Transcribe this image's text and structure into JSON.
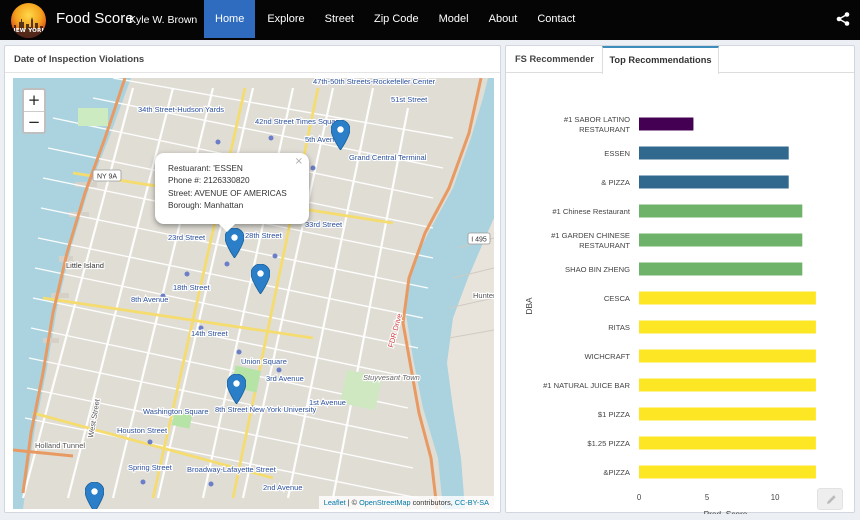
{
  "navbar": {
    "logo_text": "NEW YORK",
    "brand": "Food Score",
    "author": "Kyle W. Brown",
    "items": [
      {
        "label": "Home",
        "active": true
      },
      {
        "label": "Explore",
        "active": false
      },
      {
        "label": "Street",
        "active": false
      },
      {
        "label": "Zip Code",
        "active": false
      },
      {
        "label": "Model",
        "active": false
      },
      {
        "label": "About",
        "active": false
      },
      {
        "label": "Contact",
        "active": false
      }
    ],
    "share_icon": "share-icon"
  },
  "map_panel": {
    "title": "Date of Inspection Violations",
    "zoom_in": "+",
    "zoom_out": "−",
    "popup": {
      "line1": "Restuarant: 'ESSEN",
      "line2": "Phone #: 2126330820",
      "line3": "Street: AVENUE OF AMERICAS",
      "line4": "Borough: Manhattan",
      "close": "×"
    },
    "attribution": {
      "leaflet": "Leaflet",
      "sep": " | © ",
      "osm": "OpenStreetMap",
      "contrib": " contributors, ",
      "license": "CC-BY-SA"
    },
    "map_labels": [
      "34th Street-Hudson Yards",
      "47th-50th Streets-Rockefeller Center",
      "42nd Street Times Square",
      "5th Avenue",
      "Grand Central Terminal",
      "51st Street",
      "NY 9A",
      "33rd Street",
      "28th Street",
      "23rd Street",
      "Little Island",
      "18th Street",
      "8th Avenue",
      "14th Street",
      "Union Square",
      "3rd Avenue",
      "1st Avenue",
      "Washington Square",
      "8th Street New York University",
      "Houston Street",
      "Spring Street",
      "Broadway-Lafayette Street",
      "Holland Tunnel",
      "I 495",
      "FDR Drive",
      "Hunters Point",
      "West Street",
      "Stuyvesant Town",
      "2nd Avenue"
    ]
  },
  "chart_panel": {
    "tabs": [
      {
        "label": "FS Recommender",
        "active": false
      },
      {
        "label": "Top Recommendations",
        "active": true
      }
    ],
    "edit_icon": "pencil-icon"
  },
  "chart_data": {
    "type": "bar",
    "orientation": "horizontal",
    "categories": [
      "#1 SABOR LATINO RESTAURANT",
      "ESSEN",
      "& PIZZA",
      "#1 Chinese Restaurant",
      "#1 GARDEN CHINESE RESTAURANT",
      "SHAO BIN ZHENG",
      "CESCA",
      "RITAS",
      "WICHCRAFT",
      "#1 NATURAL JUICE BAR",
      "$1 PIZZA",
      "$1.25 PIZZA",
      "&PIZZA"
    ],
    "values": [
      4,
      11,
      11,
      12,
      12,
      12,
      13,
      13,
      13,
      13,
      13,
      13,
      13
    ],
    "colors": [
      "#440154",
      "#31688e",
      "#31688e",
      "#6fb36a",
      "#6fb36a",
      "#6fb36a",
      "#fde725",
      "#fde725",
      "#fde725",
      "#fde725",
      "#fde725",
      "#fde725",
      "#fde725"
    ],
    "xlabel": "Pred_Score",
    "ylabel": "DBA",
    "xticks": [
      0,
      5,
      10
    ],
    "xlim": [
      0,
      13.3
    ],
    "grid": false
  }
}
